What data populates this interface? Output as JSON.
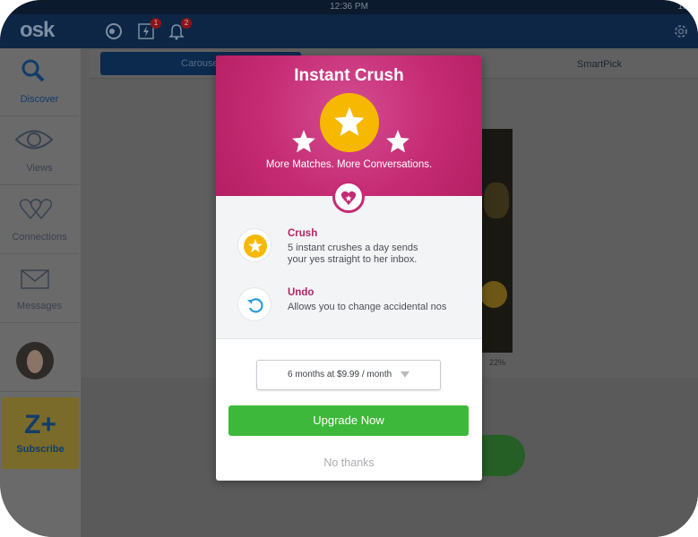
{
  "status_bar": {
    "time": "12:36 PM",
    "battery": "100"
  },
  "app": {
    "logo": "osk"
  },
  "header": {
    "flash_badge": "1",
    "bell_badge": "2"
  },
  "sidebar": {
    "items": [
      {
        "label": "Discover",
        "icon": "search-icon"
      },
      {
        "label": "Views",
        "icon": "eye-icon"
      },
      {
        "label": "Connections",
        "icon": "hearts-icon"
      },
      {
        "label": "Messages",
        "icon": "envelope-icon"
      }
    ],
    "subscribe": {
      "symbol": "Z+",
      "label": "Subscribe"
    }
  },
  "main": {
    "tabs": [
      "Carousel",
      "SmartPick"
    ],
    "match_percent": "22%"
  },
  "modal": {
    "title": "Instant Crush",
    "subtitle": "More Matches. More Conversations.",
    "features": [
      {
        "title": "Crush",
        "description": "5 instant crushes a day sends\nyour yes straight to her inbox.",
        "icon": "star-icon"
      },
      {
        "title": "Undo",
        "description": "Allows you to change accidental nos",
        "icon": "undo-icon"
      }
    ],
    "plan": {
      "selected": "6 months at $9.99 / month"
    },
    "upgrade_label": "Upgrade Now",
    "decline_label": "No thanks"
  },
  "colors": {
    "brand_pink": "#c52b73",
    "accent_yellow": "#f6b800",
    "upgrade_green": "#3db83a",
    "header_navy": "#0d2645"
  }
}
